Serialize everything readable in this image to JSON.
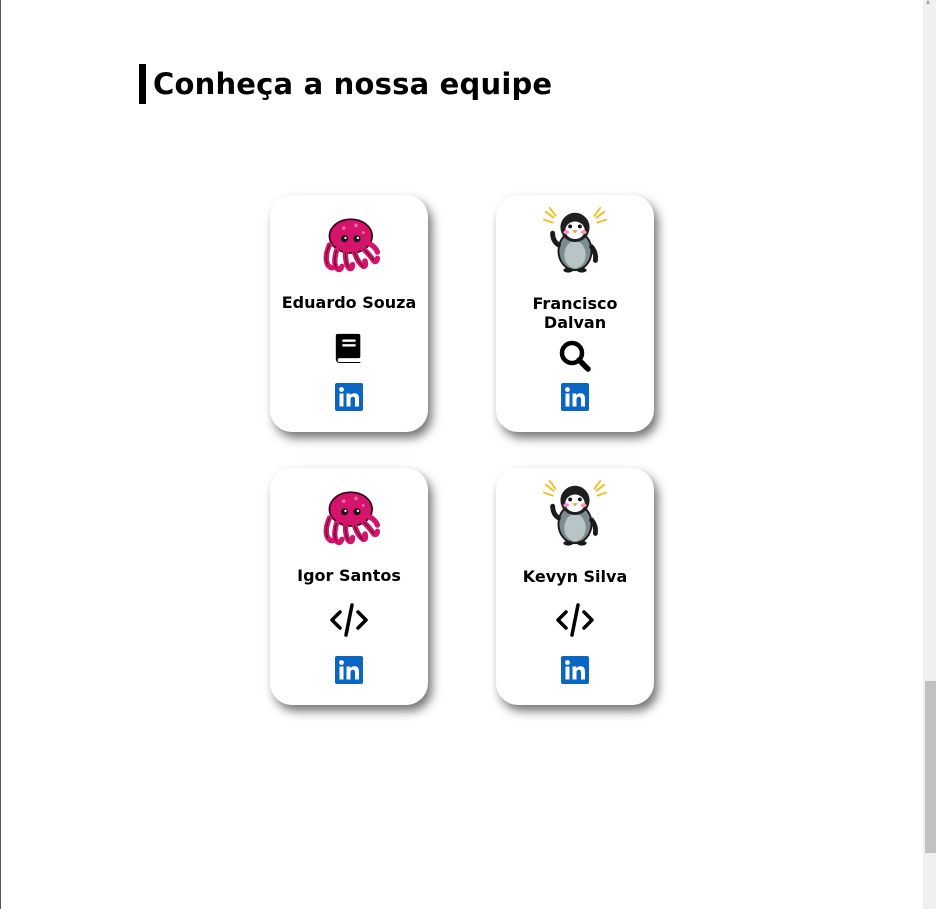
{
  "page": {
    "title": "Conheça a nossa equipe"
  },
  "team": [
    {
      "name": "Eduardo Souza",
      "avatar": "octopus-avatar",
      "role_icon": "book-icon"
    },
    {
      "name": "Francisco Dalvan",
      "avatar": "penguin-avatar",
      "role_icon": "search-icon"
    },
    {
      "name": "Igor Santos",
      "avatar": "octopus-avatar",
      "role_icon": "code-icon"
    },
    {
      "name": "Kevyn Silva",
      "avatar": "penguin-avatar",
      "role_icon": "code-icon"
    }
  ],
  "colors": {
    "linkedin": "#0a66c2",
    "octopus": "#d4146a",
    "penguin_body": "#7c8b8f",
    "accent_bar": "#000000"
  }
}
